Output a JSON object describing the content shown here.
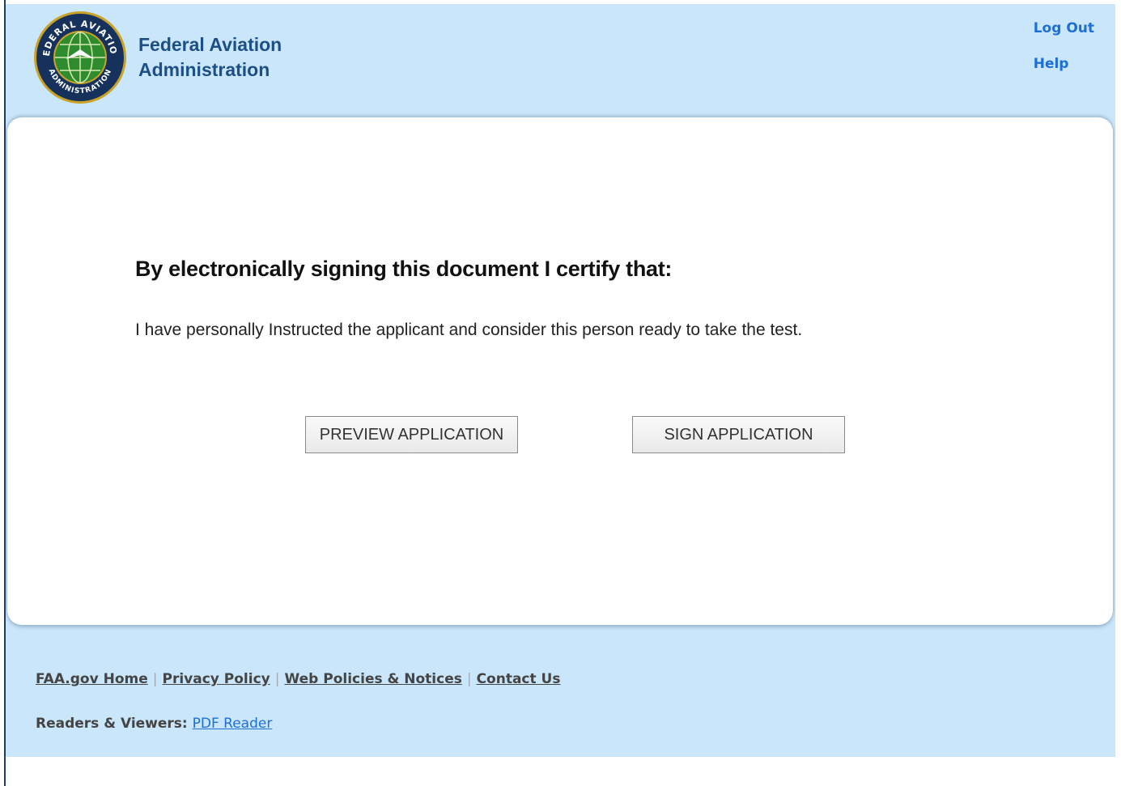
{
  "header": {
    "agency_line1": "Federal Aviation",
    "agency_line2": "Administration",
    "logo_text_top": "FEDERAL AVIATION",
    "logo_text_bottom": "ADMINISTRATION",
    "links": [
      {
        "label": "Log Out"
      },
      {
        "label": "Help"
      }
    ]
  },
  "main": {
    "heading": "By electronically signing this document I certify that:",
    "statement": "I have personally Instructed the applicant and consider this person ready to take the test.",
    "preview_button": "PREVIEW APPLICATION",
    "sign_button": "SIGN APPLICATION"
  },
  "footer": {
    "links": [
      {
        "label": "FAA.gov Home"
      },
      {
        "label": "Privacy Policy"
      },
      {
        "label": "Web Policies & Notices"
      },
      {
        "label": "Contact Us"
      }
    ],
    "separator": "|",
    "readers_label": "Readers & Viewers:",
    "pdf_reader_link": "PDF Reader"
  },
  "colors": {
    "page_background": "#cae6fa",
    "agency_text": "#1d4f87",
    "link_blue": "#1d6fd6"
  }
}
